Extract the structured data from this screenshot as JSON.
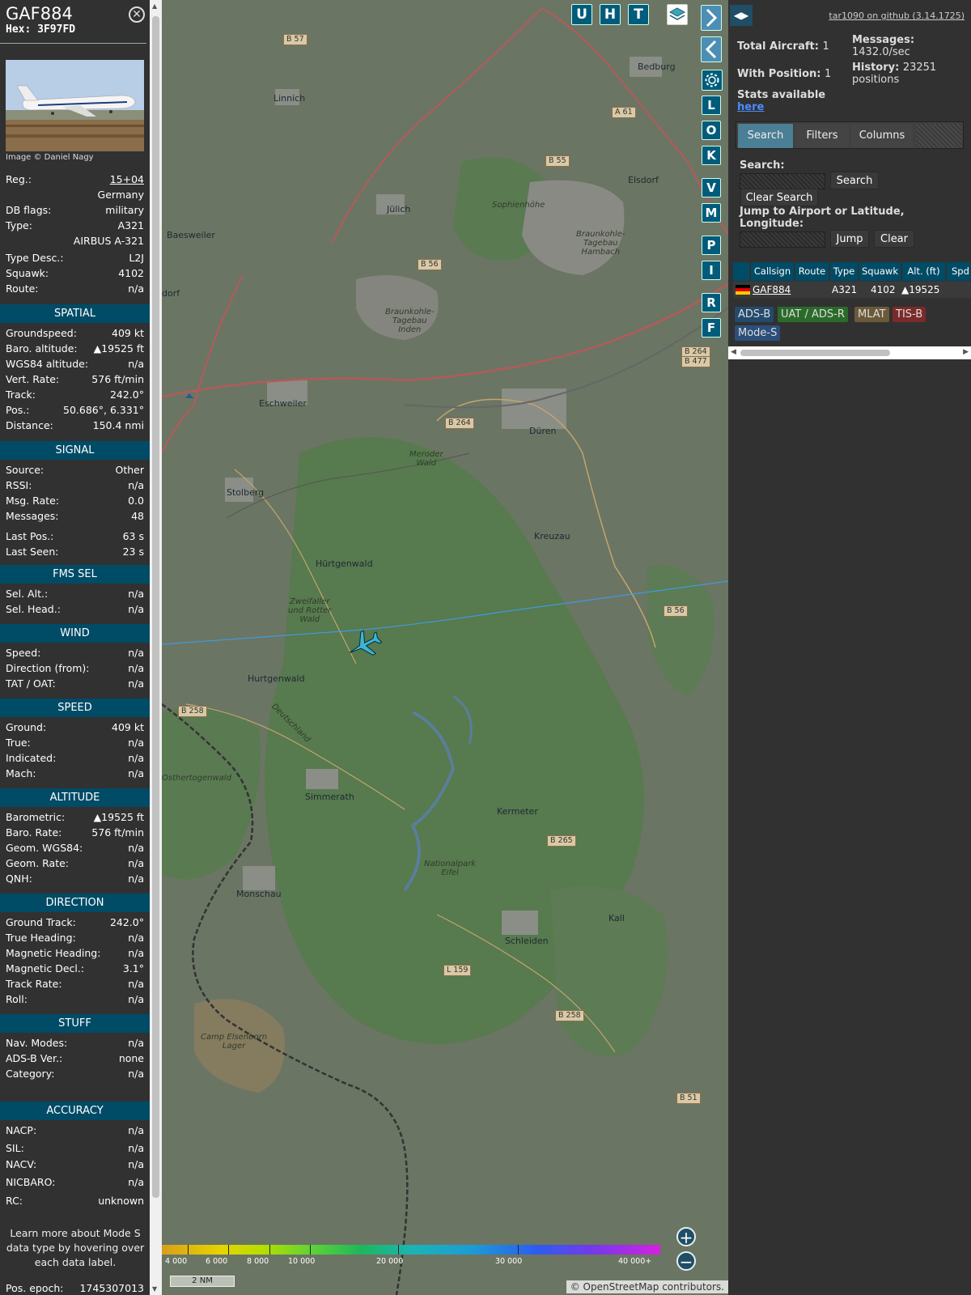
{
  "aircraft": {
    "callsign": "GAF884",
    "hex": "Hex: 3F97FD",
    "image_credit": "Image © Daniel Nagy"
  },
  "details": [
    {
      "k": "Reg.:",
      "v": "15+04"
    },
    {
      "k": "",
      "v": "Germany"
    },
    {
      "k": "DB flags:",
      "v": "military"
    },
    {
      "k": "Type:",
      "v": "A321"
    },
    {
      "k": "",
      "v": "AIRBUS A-321"
    },
    {
      "k": "Type Desc.:",
      "v": "L2J"
    },
    {
      "k": "Squawk:",
      "v": "4102"
    },
    {
      "k": "Route:",
      "v": "n/a"
    }
  ],
  "sections": {
    "spatial": "SPATIAL",
    "signal": "SIGNAL",
    "fms": "FMS SEL",
    "wind": "WIND",
    "speed": "SPEED",
    "altitude": "ALTITUDE",
    "direction": "DIRECTION",
    "stuff": "STUFF",
    "accuracy": "ACCURACY"
  },
  "spatial": [
    {
      "k": "Groundspeed:",
      "v": "409 kt"
    },
    {
      "k": "Baro. altitude:",
      "v": "▲19525 ft"
    },
    {
      "k": "WGS84 altitude:",
      "v": "n/a"
    },
    {
      "k": "Vert. Rate:",
      "v": "576 ft/min"
    },
    {
      "k": "Track:",
      "v": "242.0°"
    },
    {
      "k": "Pos.:",
      "v": "50.686°, 6.331°"
    },
    {
      "k": "Distance:",
      "v": "150.4 nmi"
    }
  ],
  "signal": [
    {
      "k": "Source:",
      "v": "Other"
    },
    {
      "k": "RSSI:",
      "v": "n/a"
    },
    {
      "k": "Msg. Rate:",
      "v": "0.0"
    },
    {
      "k": "Messages:",
      "v": "48"
    },
    {
      "k": "Last Pos.:",
      "v": "63 s"
    },
    {
      "k": "Last Seen:",
      "v": "23 s"
    }
  ],
  "fms": [
    {
      "k": "Sel. Alt.:",
      "v": "n/a"
    },
    {
      "k": "Sel. Head.:",
      "v": "n/a"
    }
  ],
  "wind": [
    {
      "k": "Speed:",
      "v": "n/a"
    },
    {
      "k": "Direction (from):",
      "v": "n/a"
    },
    {
      "k": "TAT / OAT:",
      "v": "n/a"
    }
  ],
  "speed": [
    {
      "k": "Ground:",
      "v": "409 kt"
    },
    {
      "k": "True:",
      "v": "n/a"
    },
    {
      "k": "Indicated:",
      "v": "n/a"
    },
    {
      "k": "Mach:",
      "v": "n/a"
    }
  ],
  "altitude": [
    {
      "k": "Barometric:",
      "v": "▲19525 ft"
    },
    {
      "k": "Baro. Rate:",
      "v": "576 ft/min"
    },
    {
      "k": "Geom. WGS84:",
      "v": "n/a"
    },
    {
      "k": "Geom. Rate:",
      "v": "n/a"
    },
    {
      "k": "QNH:",
      "v": "n/a"
    }
  ],
  "direction": [
    {
      "k": "Ground Track:",
      "v": "242.0°"
    },
    {
      "k": "True Heading:",
      "v": "n/a"
    },
    {
      "k": "Magnetic Heading:",
      "v": "n/a"
    },
    {
      "k": "Magnetic Decl.:",
      "v": "3.1°"
    },
    {
      "k": "Track Rate:",
      "v": "n/a"
    },
    {
      "k": "Roll:",
      "v": "n/a"
    }
  ],
  "stuff": [
    {
      "k": "Nav. Modes:",
      "v": "n/a"
    },
    {
      "k": "ADS-B Ver.:",
      "v": "none"
    },
    {
      "k": "Category:",
      "v": "n/a"
    }
  ],
  "accuracy": [
    {
      "k": "NACP:",
      "v": "n/a"
    },
    {
      "k": "SIL:",
      "v": "n/a"
    },
    {
      "k": "NACV:",
      "v": "n/a"
    },
    {
      "k": "NICBARO:",
      "v": "n/a"
    },
    {
      "k": "RC:",
      "v": "unknown"
    }
  ],
  "learn_more": "Learn more about Mode S data type by hovering over each data label.",
  "pos_epoch": {
    "k": "Pos. epoch:",
    "v": "1745307013"
  },
  "map": {
    "buttons": [
      "U",
      "H",
      "T"
    ],
    "side_buttons": [
      "L",
      "O",
      "K",
      "V",
      "M",
      "P",
      "I",
      "R",
      "F"
    ],
    "places": [
      {
        "t": "Linnich"
      },
      {
        "t": "Bedburg"
      },
      {
        "t": "Jülich"
      },
      {
        "t": "Elsdorf"
      },
      {
        "t": "Baesweiler"
      },
      {
        "t": "Eschweiler"
      },
      {
        "t": "Düren"
      },
      {
        "t": "Stolberg"
      },
      {
        "t": "Kreuzau"
      },
      {
        "t": "Hürtgenwald"
      },
      {
        "t": "Hurtgenwald"
      },
      {
        "t": "Simmerath"
      },
      {
        "t": "Kermeter"
      },
      {
        "t": "Monschau"
      },
      {
        "t": "Schleiden"
      },
      {
        "t": "Kall"
      },
      {
        "t": "dorf"
      }
    ],
    "italic_places": [
      {
        "t": "Braunkohle-\nTagebau\nHambach"
      },
      {
        "t": "Braunkohle-\nTagebau\nInden"
      },
      {
        "t": "Sophienhöhe"
      },
      {
        "t": "Meroder\nWald"
      },
      {
        "t": "Zweifaller\nund Rotter\nWald"
      },
      {
        "t": "Nationalpark\nEifel"
      },
      {
        "t": "Camp Elsenborn\nLager"
      },
      {
        "t": "Osthertogenwald"
      },
      {
        "t": "Deutschland"
      }
    ],
    "road_signs": [
      "B 57",
      "A 61",
      "B 55",
      "B 56",
      "B 264",
      "B 264",
      "B 477",
      "B 56",
      "B 258",
      "B 265",
      "L 159",
      "B 258",
      "B 51"
    ],
    "legend_labels": [
      "4 000",
      "6 000",
      "8 000",
      "10 000",
      "20 000",
      "30 000",
      "40 000+"
    ],
    "scale": "2 NM",
    "attribution": "© OpenStreetMap contributors."
  },
  "side": {
    "github": "tar1090 on github (3.14.1725)",
    "total_aircraft_label": "Total Aircraft:",
    "total_aircraft": "1",
    "with_position_label": "With Position:",
    "with_position": "1",
    "messages_label": "Messages:",
    "messages": "1432.0/sec",
    "history_label": "History:",
    "history": "23251",
    "history_unit": "positions",
    "stats_label": "Stats available",
    "stats_link": "here",
    "tabs": [
      "Search",
      "Filters",
      "Columns"
    ],
    "search_label": "Search:",
    "search_button": "Search",
    "clear_search_button": "Clear Search",
    "jump_label": "Jump to Airport or Latitude, Longitude:",
    "jump_button": "Jump",
    "clear_button": "Clear",
    "columns": [
      "Callsign",
      "Route",
      "Type",
      "Squawk",
      "Alt. (ft)",
      "Spd"
    ],
    "row": {
      "callsign": "GAF884",
      "type": "A321",
      "squawk": "4102",
      "alt": "▲19525"
    },
    "chips": [
      "ADS-B",
      "UAT / ADS-R",
      "MLAT",
      "TIS-B",
      "Mode-S"
    ]
  },
  "colors": {
    "section": "#004b66",
    "aircraft": "#3ab6d3",
    "track": "#3d9be0",
    "adsb": "#234a6d",
    "uat": "#2a6b2a",
    "mlat": "#6b5a3a",
    "tisb": "#7a2a2a",
    "modes": "#2c4e7a"
  }
}
